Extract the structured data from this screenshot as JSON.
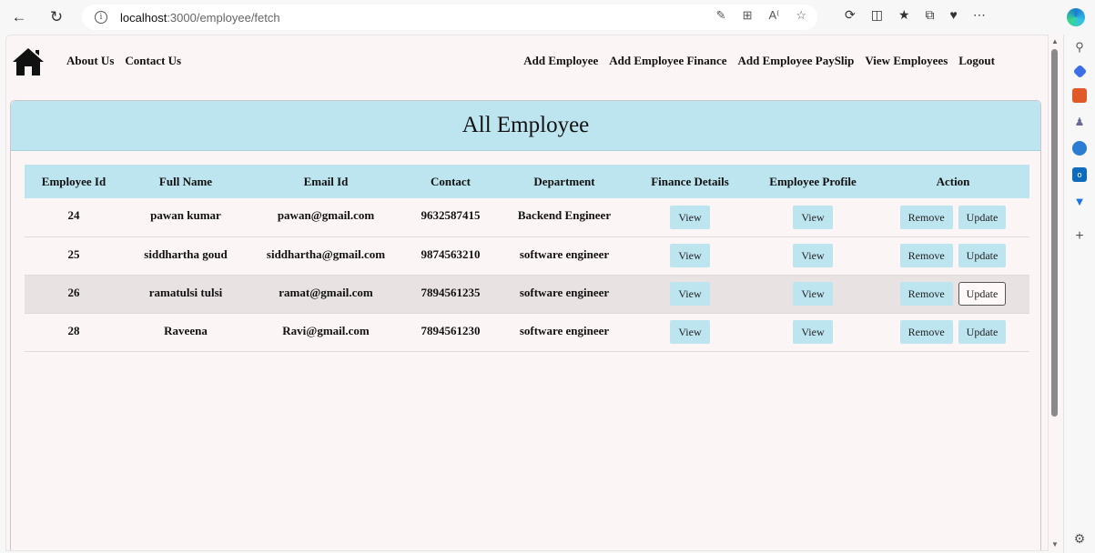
{
  "browser": {
    "url_host": "localhost",
    "url_path": ":3000/employee/fetch"
  },
  "navbar": {
    "left_links": [
      "About Us",
      "Contact Us"
    ],
    "right_links": [
      "Add Employee",
      "Add Employee Finance",
      "Add Employee PaySlip",
      "View Employees",
      "Logout"
    ]
  },
  "card": {
    "title": "All Employee"
  },
  "table": {
    "headers": [
      "Employee Id",
      "Full Name",
      "Email Id",
      "Contact",
      "Department",
      "Finance Details",
      "Employee Profile",
      "Action"
    ],
    "rows": [
      {
        "id": "24",
        "name": "pawan kumar",
        "email": "pawan@gmail.com",
        "contact": "9632587415",
        "department": "Backend Engineer"
      },
      {
        "id": "25",
        "name": "siddhartha goud",
        "email": "siddhartha@gmail.com",
        "contact": "9874563210",
        "department": "software engineer"
      },
      {
        "id": "26",
        "name": "ramatulsi tulsi",
        "email": "ramat@gmail.com",
        "contact": "7894561235",
        "department": "software engineer"
      },
      {
        "id": "28",
        "name": "Raveena",
        "email": "Ravi@gmail.com",
        "contact": "7894561230",
        "department": "software engineer"
      }
    ],
    "view_label": "View",
    "remove_label": "Remove",
    "update_label": "Update"
  },
  "colors": {
    "header_bg": "#bde5f0",
    "page_bg": "#fcf5f5",
    "row_highlight": "#e9e2e2"
  }
}
